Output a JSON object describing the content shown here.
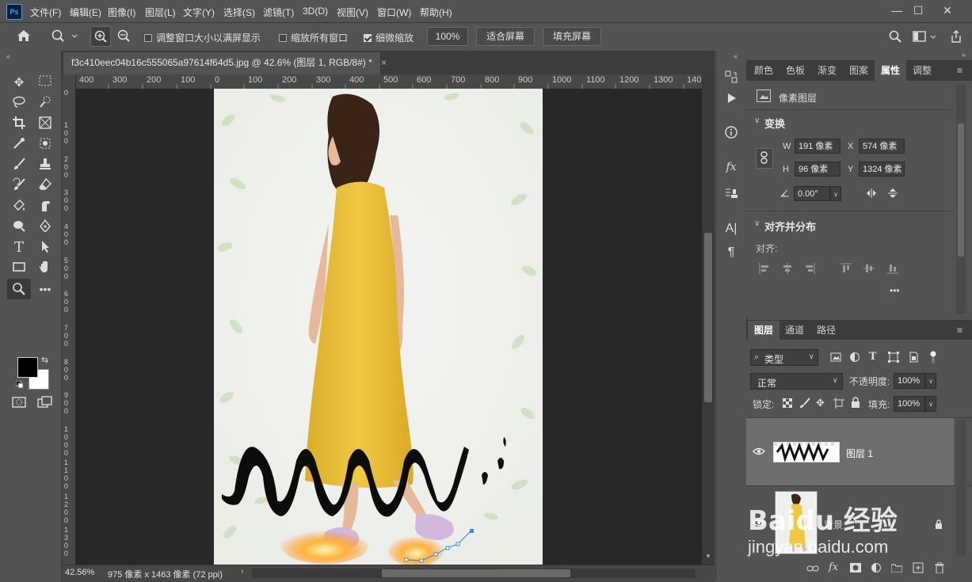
{
  "app": {
    "logo": "Ps"
  },
  "menu": [
    "文件(F)",
    "编辑(E)",
    "图像(I)",
    "图层(L)",
    "文字(Y)",
    "选择(S)",
    "滤镜(T)",
    "3D(D)",
    "视图(V)",
    "窗口(W)",
    "帮助(H)"
  ],
  "window_controls": {
    "minimize": "—",
    "restore": "☐",
    "close": "✕"
  },
  "options_bar": {
    "resize_windows_label": "调整窗口大小以满屏显示",
    "resize_windows_checked": false,
    "zoom_all_label": "缩放所有窗口",
    "zoom_all_checked": false,
    "scrubby_zoom_label": "细微缩放",
    "scrubby_zoom_checked": true,
    "zoom_value": "100%",
    "fit_screen": "适合屏幕",
    "fill_screen": "填充屏幕"
  },
  "document": {
    "tab_title": "f3c410eec04b16c555065a97614f64d5.jpg @ 42.6% (图层 1, RGB/8#) *",
    "tab_close": "×"
  },
  "ruler": {
    "top": [
      "400",
      "300",
      "200",
      "100",
      "0",
      "100",
      "200",
      "300",
      "400",
      "500",
      "600",
      "700",
      "800",
      "900",
      "1000",
      "1100",
      "1200",
      "1300",
      "140"
    ],
    "left": [
      "0",
      "1 0 0",
      "2 0 0",
      "3 0 0",
      "4 0 0",
      "5 0 0",
      "6 0 0",
      "7 0 0",
      "8 0 0",
      "9 0 0",
      "1 0 0 0",
      "1 1 0 0",
      "1 2 0 0",
      "1 3 0 0",
      "1 4 0 0"
    ]
  },
  "status": {
    "zoom": "42.56%",
    "size": "975 像素 x 1463 像素 (72 ppi)"
  },
  "properties_panel": {
    "tabs": [
      "颜色",
      "色板",
      "渐变",
      "图案",
      "属性",
      "调整"
    ],
    "active_tab": "属性",
    "layer_kind": "像素图层",
    "transform_title": "变换",
    "w_label": "W",
    "w_value": "191 像素",
    "h_label": "H",
    "h_value": "96 像素",
    "x_label": "X",
    "x_value": "574 像素",
    "y_label": "Y",
    "y_value": "1324 像素",
    "angle_value": "0.00°",
    "align_title": "对齐并分布",
    "align_label": "对齐:"
  },
  "layers_panel": {
    "tabs": [
      "图层",
      "通道",
      "路径"
    ],
    "active_tab": "图层",
    "filter_kind": "类型",
    "blend_mode": "正常",
    "opacity_label": "不透明度:",
    "opacity_value": "100%",
    "lock_label": "锁定:",
    "fill_label": "填充:",
    "fill_value": "100%",
    "layers": [
      {
        "name": "图层 1",
        "visible": true,
        "selected": true
      },
      {
        "name": "背景",
        "visible": true,
        "selected": false,
        "locked": true
      }
    ]
  },
  "watermark": {
    "line1": "Baidu 经验",
    "line2": "jingyan.baidu.com"
  }
}
